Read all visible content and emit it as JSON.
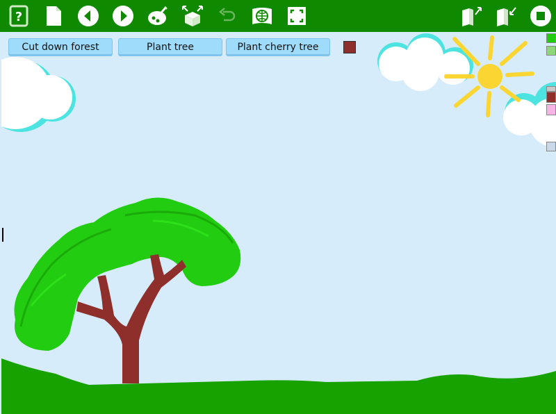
{
  "toolbar": {
    "left_tools": [
      {
        "icon": "help-icon"
      },
      {
        "icon": "document-icon"
      },
      {
        "icon": "previous-icon"
      },
      {
        "icon": "next-icon"
      },
      {
        "icon": "paint-palette-icon"
      },
      {
        "icon": "share-box-icon"
      },
      {
        "icon": "undo-icon"
      },
      {
        "icon": "globe-map-icon"
      },
      {
        "icon": "fullscreen-icon"
      }
    ],
    "right_tools": [
      {
        "icon": "expand-book-icon"
      },
      {
        "icon": "collapse-book-icon"
      },
      {
        "icon": "stop-icon"
      }
    ],
    "colors": {
      "bar": "#0f8a00",
      "icon": "#ffffff"
    }
  },
  "actions": {
    "cut_forest_label": "Cut down forest",
    "plant_tree_label": "Plant tree",
    "plant_cherry_label": "Plant cherry tree"
  },
  "scene": {
    "sky_color": "#d6ecfa",
    "grass_color": "#18a200",
    "trunk_color": "#8e2f2b",
    "foliage_color": "#22cc10",
    "sun_color": "#fbd531",
    "selected_color": "#8e2f2b"
  }
}
